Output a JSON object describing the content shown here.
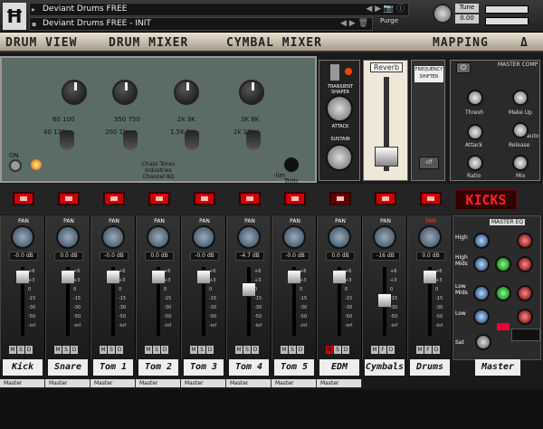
{
  "header": {
    "instrument": "Deviant Drums FREE",
    "snapshot": "Deviant Drums FREE - INIT",
    "purge": "Purge",
    "tune_label": "Tune",
    "tune_value": "0.00"
  },
  "tabs": [
    "DRUM VIEW",
    "DRUM MIXER",
    "CYMBAL MIXER",
    "MAPPING"
  ],
  "panel": {
    "scale_a": "60  100",
    "scale_b": "40        120",
    "scale_c": "350  750",
    "scale_d": "200       1k",
    "scale_e": "2k  3K",
    "scale_f": "1.5K       5K",
    "scale_g": "3K  8K",
    "scale_h": "2k        13k",
    "chas": "Chass Tones Industries Channel 8Q",
    "on": "ON",
    "trim": "Trim",
    "lim": "-lim"
  },
  "transient": {
    "title": "TRANSIENT SHAPER",
    "attack": "ATTACK",
    "sustain": "SUSTAIN"
  },
  "reverb": {
    "title": "Reverb"
  },
  "freq": {
    "title": "FREQUENCY SHIFTER",
    "button": "off"
  },
  "comp": {
    "title": "MASTER COMP",
    "thresh": "Thresh",
    "makeup": "Make Up",
    "attack": "Attack",
    "release": "Release",
    "ratio": "Ratio",
    "mix": "Mix",
    "auto": "auto"
  },
  "display": "KICKS",
  "channels": [
    {
      "name": "Kick",
      "db": "-0.0 dB",
      "out": "Master"
    },
    {
      "name": "Snare",
      "db": "0.0 dB",
      "out": "Master"
    },
    {
      "name": "Tom 1",
      "db": "-0.0 dB",
      "out": "Master"
    },
    {
      "name": "Tom 2",
      "db": "0.0 dB",
      "out": "Master"
    },
    {
      "name": "Tom 3",
      "db": "-0.0 dB",
      "out": "Master"
    },
    {
      "name": "Tom 4",
      "db": "-4.7 dB",
      "out": "Master"
    },
    {
      "name": "Tom 5",
      "db": "-0.0 dB",
      "out": "Master"
    },
    {
      "name": "EDM",
      "db": "0.0 dB",
      "out": "Master"
    },
    {
      "name": "Cymbals",
      "db": "-16 dB",
      "out": ""
    },
    {
      "name": "Drums",
      "db": "0.0 dB",
      "out": ""
    }
  ],
  "pan_label": "PAN",
  "master": {
    "name": "Master",
    "eq_title": "MASTER EQ",
    "high": "High",
    "high_mids": "High Mids",
    "low_mids": "Low Mids",
    "low": "Low",
    "sat": "Sat"
  }
}
